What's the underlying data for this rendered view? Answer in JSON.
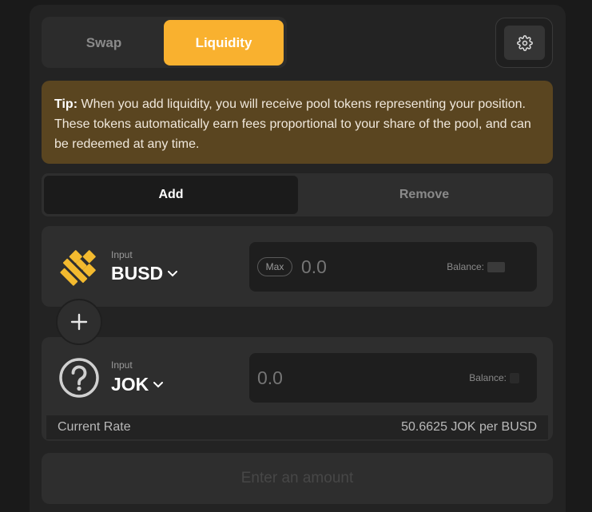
{
  "tabs": {
    "swap": "Swap",
    "liquidity": "Liquidity"
  },
  "settings": {
    "icon": "gear-icon"
  },
  "tip": {
    "label": "Tip:",
    "text": " When you add liquidity, you will receive pool tokens representing your position. These tokens automatically earn fees proportional to your share of the pool, and can be redeemed at any time."
  },
  "mode": {
    "add": "Add",
    "remove": "Remove"
  },
  "input_a": {
    "label": "Input",
    "token": "BUSD",
    "icon": "busd-logo-icon",
    "max_label": "Max",
    "placeholder": "0.0",
    "balance_label": "Balance:"
  },
  "input_b": {
    "label": "Input",
    "token": "JOK",
    "icon": "unknown-token-icon",
    "placeholder": "0.0",
    "balance_label": "Balance:"
  },
  "rate": {
    "label": "Current Rate",
    "value": "50.6625 JOK per BUSD"
  },
  "submit": {
    "label": "Enter an amount"
  },
  "colors": {
    "accent": "#f9b12f",
    "tip_bg": "#5a4520",
    "busd": "#f3ba2f"
  }
}
